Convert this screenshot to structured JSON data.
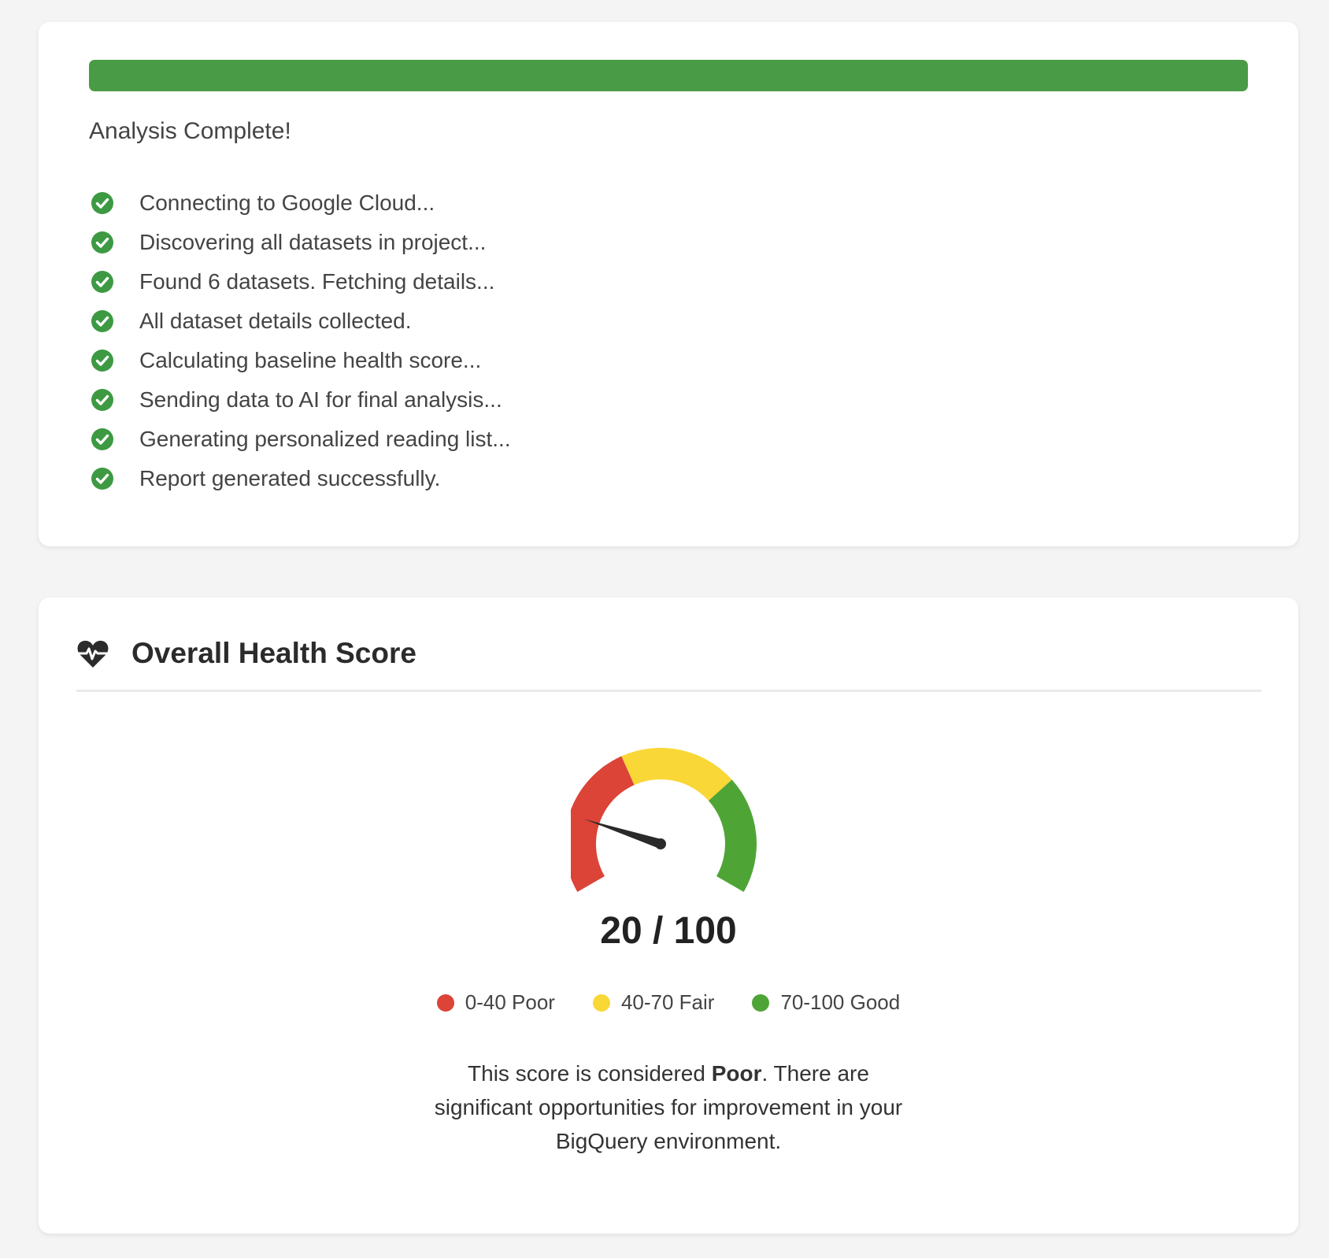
{
  "progress": {
    "percent": 100,
    "bar_color": "#4a9b45",
    "status": "Analysis Complete!",
    "steps": [
      {
        "label": "Connecting to Google Cloud...",
        "icon": "check-circle-icon"
      },
      {
        "label": "Discovering all datasets in project...",
        "icon": "check-circle-icon"
      },
      {
        "label": "Found 6 datasets. Fetching details...",
        "icon": "check-circle-icon"
      },
      {
        "label": "All dataset details collected.",
        "icon": "check-circle-icon"
      },
      {
        "label": "Calculating baseline health score...",
        "icon": "check-circle-icon"
      },
      {
        "label": "Sending data to AI for final analysis...",
        "icon": "check-circle-icon"
      },
      {
        "label": "Generating personalized reading list...",
        "icon": "check-circle-icon"
      },
      {
        "label": "Report generated successfully.",
        "icon": "check-circle-icon"
      }
    ],
    "check_color": "#3d9a43"
  },
  "health": {
    "icon": "heartbeat-icon",
    "title": "Overall Health Score",
    "score": 20,
    "max": 100,
    "score_text": "20 / 100",
    "bands": [
      {
        "label": "0-40 Poor",
        "from": 0,
        "to": 40,
        "color": "#db4437"
      },
      {
        "label": "40-70 Fair",
        "from": 40,
        "to": 70,
        "color": "#f9d737"
      },
      {
        "label": "70-100 Good",
        "from": 70,
        "to": 100,
        "color": "#4ea536"
      }
    ],
    "summary_prefix": "This score is considered ",
    "summary_rating": "Poor",
    "summary_suffix": ". There are significant opportunities for improvement in your BigQuery environment."
  }
}
